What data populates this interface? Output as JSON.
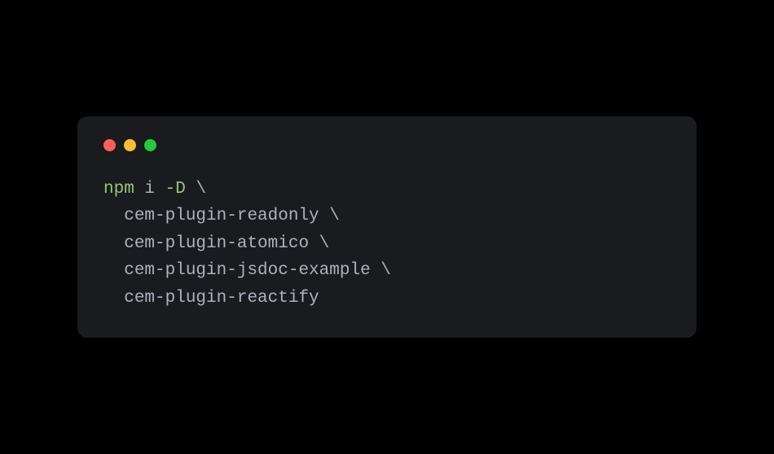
{
  "terminal": {
    "line1": {
      "command": "npm",
      "subcommand": "i",
      "flag": "-D",
      "continuation": "\\"
    },
    "line2": {
      "indent": "  ",
      "package": "cem-plugin-readonly",
      "continuation": "\\"
    },
    "line3": {
      "indent": "  ",
      "package": "cem-plugin-atomico",
      "continuation": "\\"
    },
    "line4": {
      "indent": "  ",
      "package": "cem-plugin-jsdoc-example",
      "continuation": "\\"
    },
    "line5": {
      "indent": "  ",
      "package": "cem-plugin-reactify"
    }
  }
}
